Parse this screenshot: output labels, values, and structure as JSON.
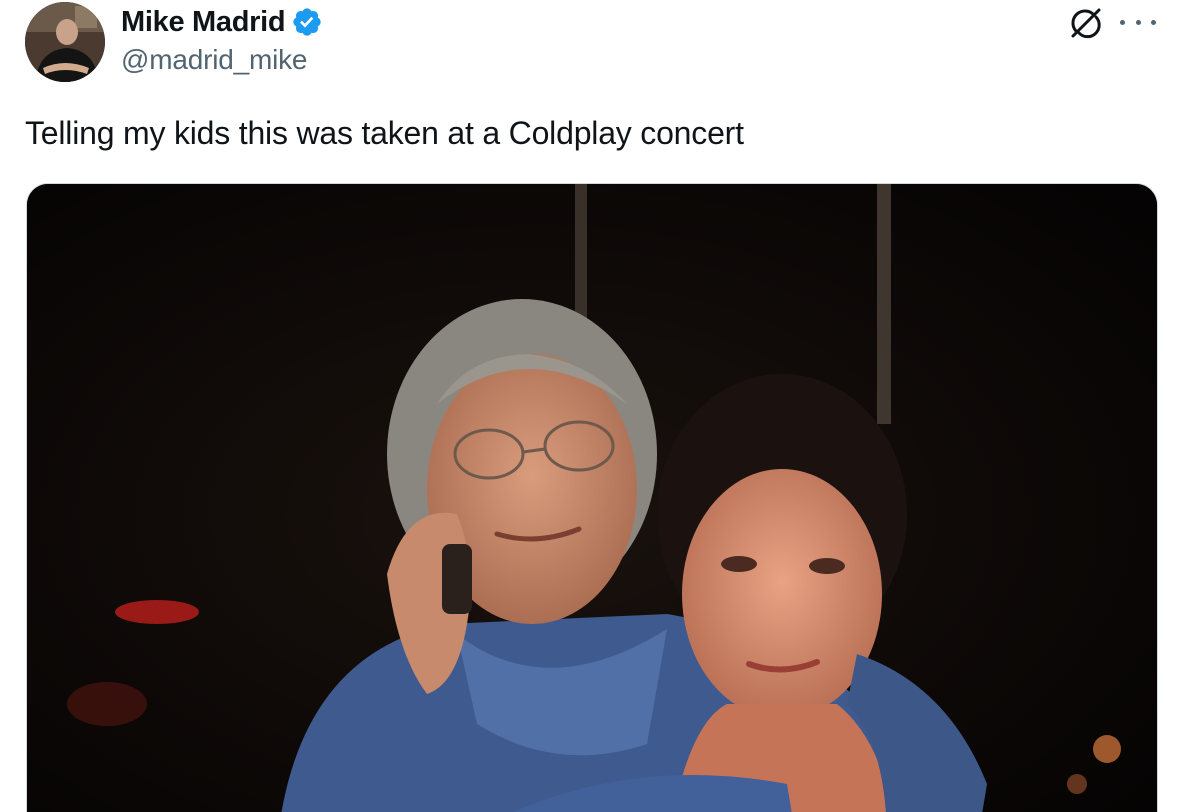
{
  "author": {
    "display_name": "Mike Madrid",
    "handle": "@madrid_mike",
    "verified": true,
    "verified_color": "#1d9bf0"
  },
  "tweet": {
    "text": "Telling my kids this was taken at a Coldplay concert"
  },
  "media": {
    "kind": "photo",
    "content": "Night-time photo of a gray-haired man in a blue sweater holding a phone to his ear, hugging a dark-haired woman from behind"
  },
  "icons": {
    "grok": "grok-icon",
    "more": "more-dots-icon",
    "verified": "verified-badge-icon"
  },
  "colors": {
    "text_primary": "#0f1419",
    "text_secondary": "#536471",
    "border": "#cfd9de"
  }
}
